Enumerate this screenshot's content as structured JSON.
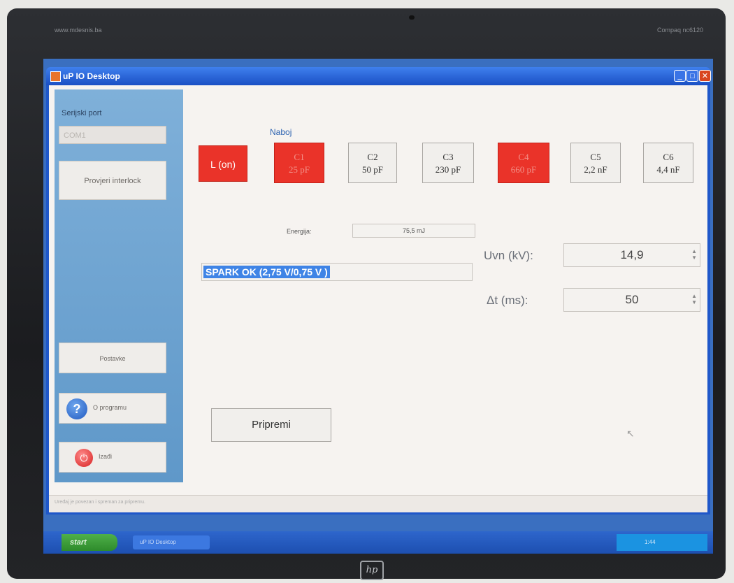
{
  "bezel": {
    "top_left_text": "www.mdesnis.ba",
    "top_right_text": "Compaq nc6120",
    "brand": "hp"
  },
  "window": {
    "title": "uP IO Desktop",
    "min_glyph": "_",
    "max_glyph": "□",
    "close_glyph": "✕"
  },
  "sidebar": {
    "serial_label": "Serijski port",
    "serial_value": "COM1",
    "interlock_button": "Provjeri interlock",
    "settings_button": "Postavke",
    "about_button": "O programu",
    "exit_button": "Izađi"
  },
  "charge": {
    "label": "Naboj",
    "l_button": "L (on)",
    "capacitors": [
      {
        "name": "C1",
        "value": "25 pF",
        "active": true
      },
      {
        "name": "C2",
        "value": "50 pF",
        "active": false
      },
      {
        "name": "C3",
        "value": "230 pF",
        "active": false
      },
      {
        "name": "C4",
        "value": "660 pF",
        "active": true
      },
      {
        "name": "C5",
        "value": "2,2 nF",
        "active": false
      },
      {
        "name": "C6",
        "value": "4,4 nF",
        "active": false
      }
    ]
  },
  "energy": {
    "label": "Energija:",
    "value": "75,5 mJ"
  },
  "status": {
    "message": "SPARK OK (2,75 V/0,75 V )"
  },
  "params": {
    "uvn_label": "Uvn (kV):",
    "uvn_value": "14,9",
    "dt_label": "Δt (ms):",
    "dt_value": "50"
  },
  "actions": {
    "prepare_button": "Pripremi"
  },
  "statusbar": {
    "text": "Uređaj je povezan i spreman za pripremu."
  },
  "taskbar": {
    "start_label": "start",
    "task_label": "uP IO Desktop",
    "tray_text": "1:44"
  },
  "colors": {
    "active_capacitor": "#ea3329",
    "sidebar": "#6fa3d2",
    "selection": "#3f84e6",
    "titlebar": "#2a66db"
  }
}
